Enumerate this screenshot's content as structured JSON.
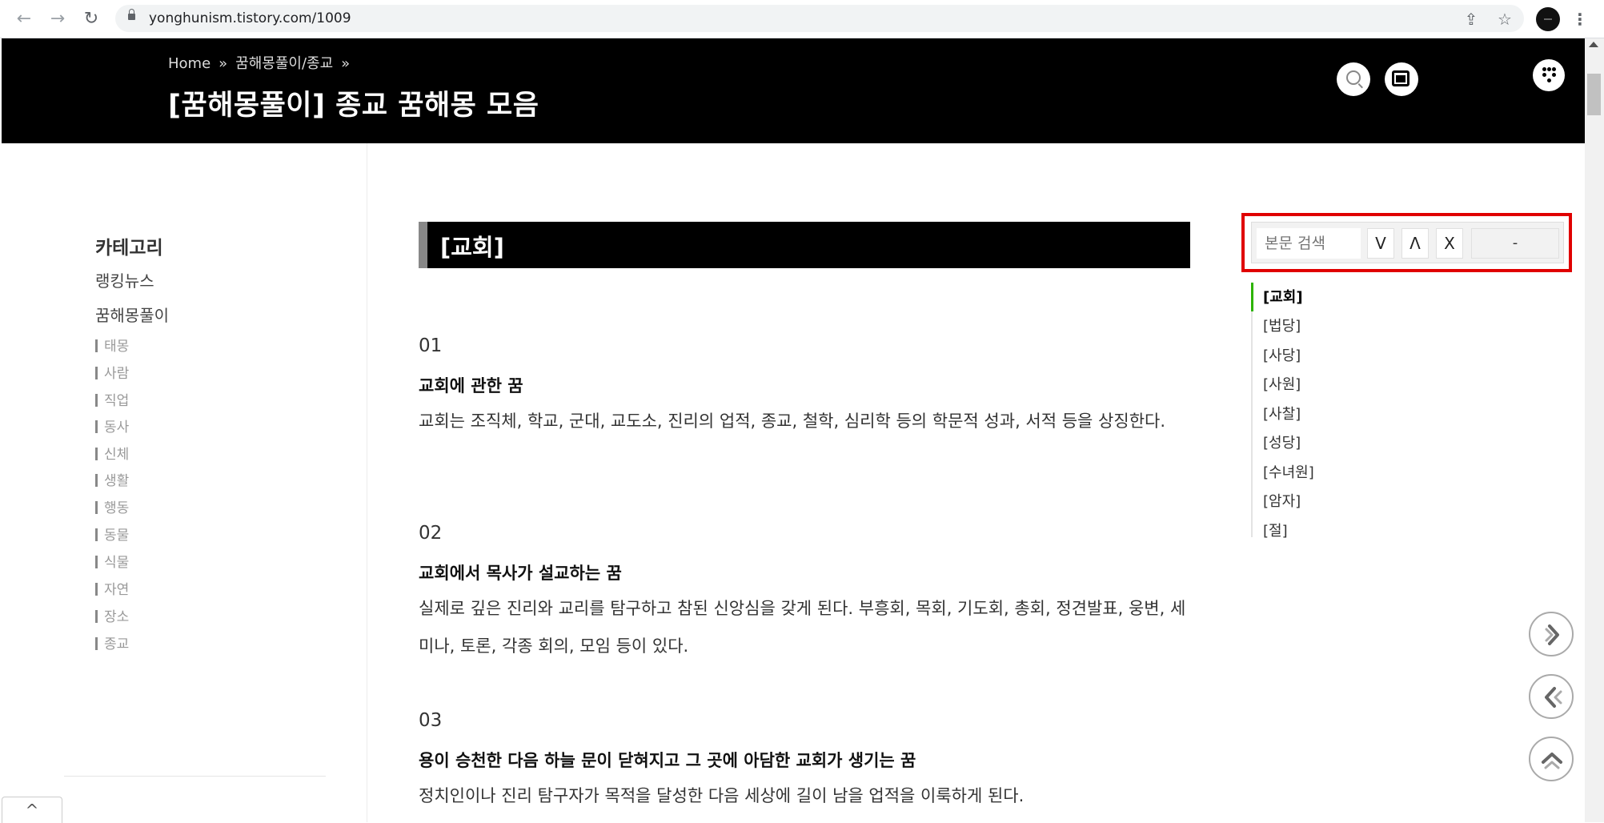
{
  "browser": {
    "url": "yonghunism.tistory.com/1009"
  },
  "header": {
    "breadcrumb": [
      "Home",
      "꿈해몽풀이/종교"
    ],
    "breadcrumb_sep": "»",
    "title": "[꿈해몽풀이] 종교 꿈해몽 모음"
  },
  "sidebar": {
    "category_title": "카테고리",
    "main_items": [
      "랭킹뉴스",
      "꿈해몽풀이"
    ],
    "sub_items": [
      "태몽",
      "사람",
      "직업",
      "동사",
      "신체",
      "생활",
      "행동",
      "동물",
      "식물",
      "자연",
      "장소",
      "종교"
    ],
    "collapse_icon": "^"
  },
  "content": {
    "section_title": "[교회]",
    "items": [
      {
        "number": "01",
        "title": "교회에 관한 꿈",
        "body": "교회는 조직체, 학교, 군대, 교도소, 진리의 업적, 종교, 철학, 심리학 등의 학문적 성과, 서적 등을 상징한다."
      },
      {
        "number": "02",
        "title": "교회에서 목사가 설교하는 꿈",
        "body": "실제로 깊은 진리와 교리를 탐구하고 참된 신앙심을 갖게 된다. 부흥회, 목회, 기도회, 총회, 정견발표, 웅변, 세미나, 토론, 각종 회의, 모임 등이 있다."
      },
      {
        "number": "03",
        "title": "용이 승천한 다음 하늘 문이 닫혀지고 그 곳에 아담한 교회가 생기는 꿈",
        "body": "정치인이나 진리 탐구자가 목적을 달성한 다음 세상에 길이 남을 업적을 이룩하게 된다."
      }
    ]
  },
  "toc": {
    "search_placeholder": "본문 검색",
    "down_label": "V",
    "up_label": "Λ",
    "close_label": "X",
    "count_label": "-",
    "items": [
      "[교회]",
      "[법당]",
      "[사당]",
      "[사원]",
      "[사찰]",
      "[성당]",
      "[수녀원]",
      "[암자]",
      "[절]"
    ],
    "active_index": 0,
    "accent_color": "#2db400",
    "highlight_color": "#e00000"
  }
}
